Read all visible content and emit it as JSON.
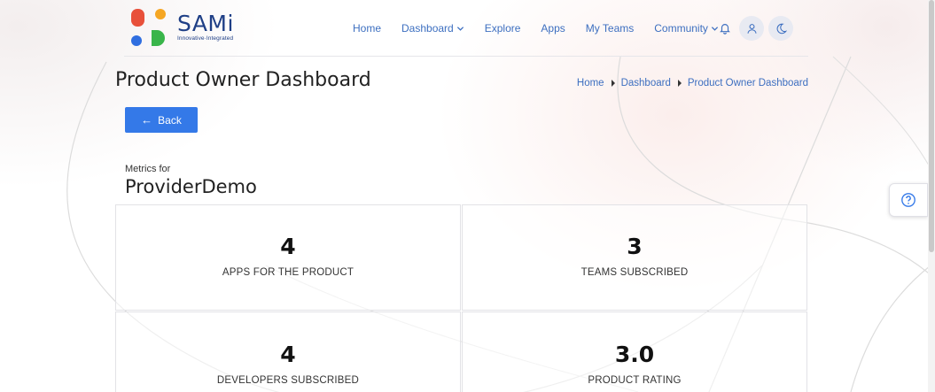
{
  "brand": {
    "name": "SAMi",
    "tagline": "Innovative·Integrated"
  },
  "nav": [
    {
      "label": "Home"
    },
    {
      "label": "Dashboard",
      "dropdown": true
    },
    {
      "label": "Explore"
    },
    {
      "label": "Apps"
    },
    {
      "label": "My Teams"
    },
    {
      "label": "Community",
      "dropdown": true
    }
  ],
  "header_icons": [
    "bell-icon",
    "user-icon",
    "moon-icon"
  ],
  "page": {
    "title": "Product Owner Dashboard",
    "breadcrumb": [
      "Home",
      "Dashboard",
      "Product Owner Dashboard"
    ],
    "back_label": "Back",
    "metrics_for_label": "Metrics for",
    "provider_name": "ProviderDemo"
  },
  "metrics": [
    {
      "value": "4",
      "label": "APPS FOR THE PRODUCT"
    },
    {
      "value": "3",
      "label": "TEAMS SUBSCRIBED"
    },
    {
      "value": "4",
      "label": "DEVELOPERS SUBSCRIBED"
    },
    {
      "value": "3.0",
      "label": "PRODUCT RATING"
    }
  ],
  "colors": {
    "accent": "#3479e8",
    "link": "#3d6fc0",
    "brand_navy": "#1f3f86",
    "logo_red": "#e8503a",
    "logo_orange": "#f5a623",
    "logo_blue": "#2f6ee0",
    "logo_green": "#39b54a"
  }
}
